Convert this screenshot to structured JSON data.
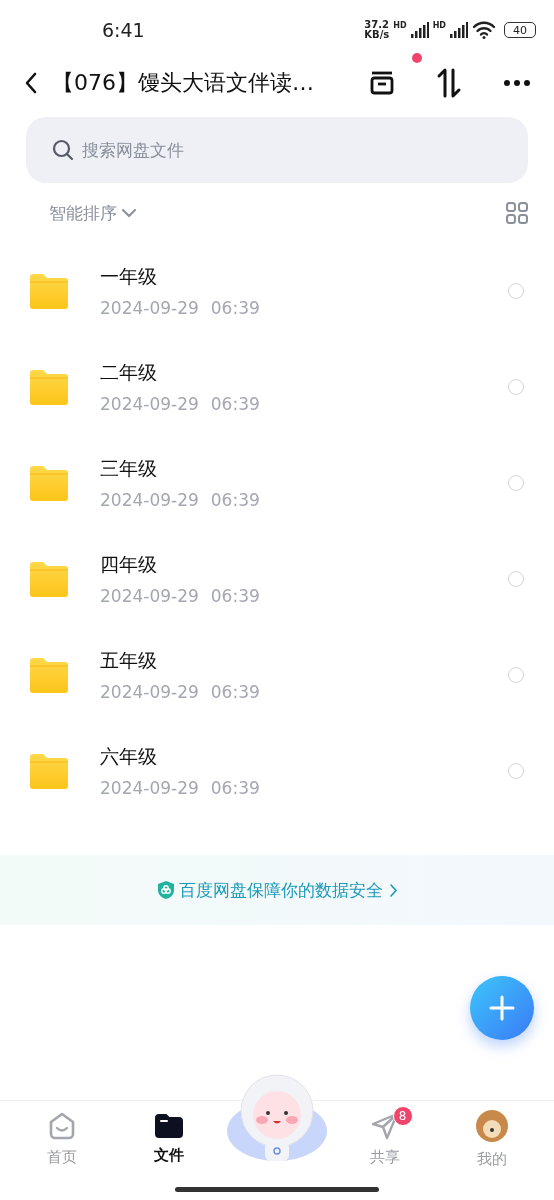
{
  "status_bar": {
    "time": "6:41",
    "speed_value": "37.2",
    "speed_unit": "KB/s",
    "sim_labels": [
      "HD",
      "HD"
    ],
    "battery": "40"
  },
  "header": {
    "title": "【076】馒头大语文伴读…",
    "notification_dot": true
  },
  "search": {
    "placeholder": "搜索网盘文件"
  },
  "sort": {
    "label": "智能排序"
  },
  "files": [
    {
      "name": "一年级",
      "date": "2024-09-29",
      "time": "06:39",
      "selected": false
    },
    {
      "name": "二年级",
      "date": "2024-09-29",
      "time": "06:39",
      "selected": false
    },
    {
      "name": "三年级",
      "date": "2024-09-29",
      "time": "06:39",
      "selected": false
    },
    {
      "name": "四年级",
      "date": "2024-09-29",
      "time": "06:39",
      "selected": false
    },
    {
      "name": "五年级",
      "date": "2024-09-29",
      "time": "06:39",
      "selected": false
    },
    {
      "name": "六年级",
      "date": "2024-09-29",
      "time": "06:39",
      "selected": false
    }
  ],
  "banner": {
    "text": "百度网盘保障你的数据安全"
  },
  "nav": [
    {
      "kind": "home",
      "label": "首页",
      "selected": false
    },
    {
      "kind": "files",
      "label": "文件",
      "selected": true
    },
    {
      "kind": "mascot"
    },
    {
      "kind": "share",
      "label": "共享",
      "selected": false,
      "badge": "8"
    },
    {
      "kind": "me",
      "label": "我的",
      "selected": false
    }
  ]
}
